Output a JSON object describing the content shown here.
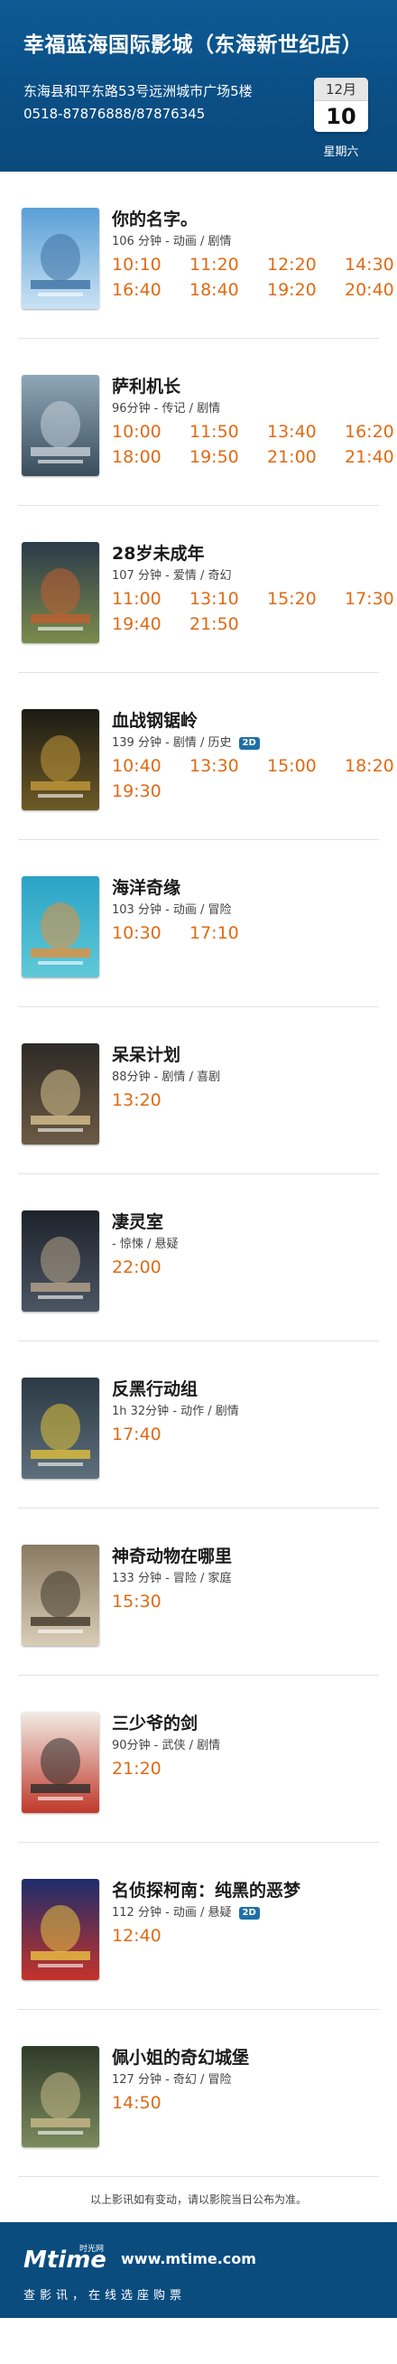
{
  "header": {
    "cinema_name": "幸福蓝海国际影城（东海新世纪店）",
    "address": "东海县和平东路53号远洲城市广场5楼",
    "phone": "0518-87876888/87876345",
    "date": {
      "month": "12月",
      "day": "10",
      "weekday": "星期六"
    }
  },
  "movies": [
    {
      "title": "你的名字。",
      "meta": "106 分钟 - 动画 / 剧情",
      "is_2d": false,
      "times": [
        "10:10",
        "11:20",
        "12:20",
        "14:30",
        "16:40",
        "18:40",
        "19:20",
        "20:40"
      ]
    },
    {
      "title": "萨利机长",
      "meta": "96分钟 - 传记 / 剧情",
      "is_2d": false,
      "times": [
        "10:00",
        "11:50",
        "13:40",
        "16:20",
        "18:00",
        "19:50",
        "21:00",
        "21:40"
      ]
    },
    {
      "title": "28岁未成年",
      "meta": "107 分钟 - 爱情 / 奇幻",
      "is_2d": false,
      "times": [
        "11:00",
        "13:10",
        "15:20",
        "17:30",
        "19:40",
        "21:50"
      ]
    },
    {
      "title": "血战钢锯岭",
      "meta": "139 分钟 - 剧情 / 历史",
      "is_2d": true,
      "times": [
        "10:40",
        "13:30",
        "15:00",
        "18:20",
        "19:30"
      ]
    },
    {
      "title": "海洋奇缘",
      "meta": "103 分钟 - 动画 / 冒险",
      "is_2d": false,
      "times": [
        "10:30",
        "17:10"
      ]
    },
    {
      "title": "呆呆计划",
      "meta": "88分钟 - 剧情 / 喜剧",
      "is_2d": false,
      "times": [
        "13:20"
      ]
    },
    {
      "title": "凄灵室",
      "meta": " - 惊悚 / 悬疑",
      "is_2d": false,
      "times": [
        "22:00"
      ]
    },
    {
      "title": "反黑行动组",
      "meta": "1h  32分钟 - 动作 / 剧情",
      "is_2d": false,
      "times": [
        "17:40"
      ]
    },
    {
      "title": "神奇动物在哪里",
      "meta": "133 分钟 - 冒险 / 家庭",
      "is_2d": false,
      "times": [
        "15:30"
      ]
    },
    {
      "title": "三少爷的剑",
      "meta": "90分钟 - 武侠 / 剧情",
      "is_2d": false,
      "times": [
        "21:20"
      ]
    },
    {
      "title": "名侦探柯南：纯黑的恶梦",
      "meta": "112 分钟 - 动画 / 悬疑",
      "is_2d": true,
      "times": [
        "12:40"
      ]
    },
    {
      "title": "佩小姐的奇幻城堡",
      "meta": "127 分钟 - 奇幻 / 冒险",
      "is_2d": false,
      "times": [
        "14:50"
      ]
    }
  ],
  "badge_label": "2D",
  "posters": [
    {
      "icon": "poster-your-name",
      "colors": [
        "#5a9fd6",
        "#c9e2f4",
        "#3d6fa3"
      ]
    },
    {
      "icon": "poster-sully",
      "colors": [
        "#8fa7b8",
        "#3a4d5c",
        "#c7d2da"
      ]
    },
    {
      "icon": "poster-28",
      "colors": [
        "#2b3a4a",
        "#7a8b4c",
        "#c25f2f"
      ]
    },
    {
      "icon": "poster-hacksaw",
      "colors": [
        "#1b1a14",
        "#6d5a26",
        "#c49a3c"
      ]
    },
    {
      "icon": "poster-moana",
      "colors": [
        "#2aa3c6",
        "#5fc9d8",
        "#e58f3a"
      ]
    },
    {
      "icon": "poster-daidai",
      "colors": [
        "#2e2a26",
        "#6b5a44",
        "#d7c28f"
      ]
    },
    {
      "icon": "poster-qilingshi",
      "colors": [
        "#1e232b",
        "#4b5563",
        "#b8a58a"
      ]
    },
    {
      "icon": "poster-fanhei",
      "colors": [
        "#2b3944",
        "#5d6f7b",
        "#e2c23b"
      ]
    },
    {
      "icon": "poster-fantastic-beasts",
      "colors": [
        "#8a7a62",
        "#d8cdb6",
        "#3e3629"
      ]
    },
    {
      "icon": "poster-sword",
      "colors": [
        "#f1ece4",
        "#c0392b",
        "#2c2c2c"
      ]
    },
    {
      "icon": "poster-conan",
      "colors": [
        "#1d2c6b",
        "#c4332b",
        "#e8c441"
      ]
    },
    {
      "icon": "poster-peregrine",
      "colors": [
        "#2f3b2a",
        "#7b8a5c",
        "#c9b98a"
      ]
    }
  ],
  "notice": "以上影讯如有变动，请以影院当日公布为准。",
  "footer": {
    "logo_text": "Mtime",
    "logo_sub": "时光网",
    "url": "www.mtime.com",
    "slogan": "查影讯，在线选座购票"
  },
  "theme": {
    "header_bg": "#0b4e84",
    "accent": "#e06a14",
    "badge": "#1f6fa8"
  }
}
